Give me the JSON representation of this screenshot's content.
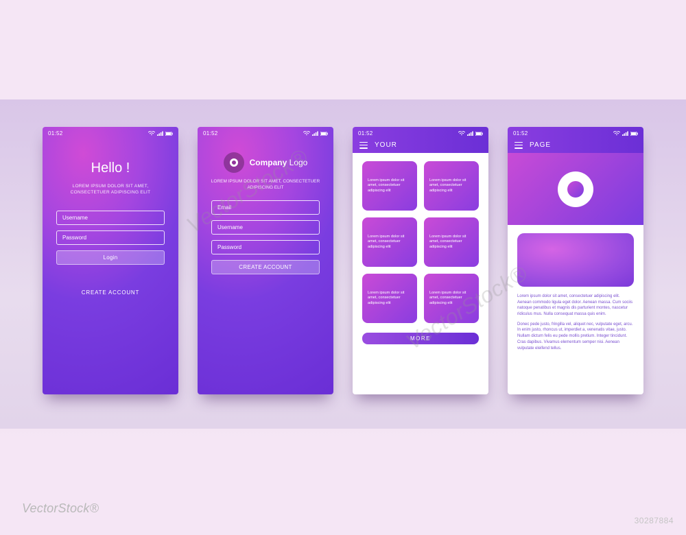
{
  "status": {
    "time": "01:52"
  },
  "screen1": {
    "title": "Hello !",
    "subtitle": "LOREM IPSUM DOLOR SIT AMET, CONSECTETUER ADIPISCING ELIT",
    "username_ph": "Username",
    "password_ph": "Password",
    "login_label": "Login",
    "create_link": "CREATE ACCOUNT"
  },
  "screen2": {
    "company_bold": "Company",
    "company_rest": " Logo",
    "subtitle": "LOREM IPSUM DOLOR SIT AMET, CONSECTETUER ADIPISCING ELIT",
    "email_ph": "Email",
    "username_ph": "Username",
    "password_ph": "Password",
    "create_label": "CREATE ACCOUNT"
  },
  "screen3": {
    "header": "YOUR",
    "card_text": "Lorem ipsum dolor sit amet, consectetuer adipiscing elit",
    "more_label": "MORE"
  },
  "screen4": {
    "header": "PAGE",
    "para1": "Lorem ipsum dolor sit amet, consectetuer adipiscing elit. Aenean commodo ligula eget dolor. Aenean massa. Cum sociis natoque penatibus et magnis dis parturient montes, nascetur ridiculus mus. Nulla consequat massa quis enim.",
    "para2": "Donec pede justo, fringilla vel, aliquet nec, vulputate eget, arcu. In enim justo, rhoncus ut, imperdiet a, venenatis vitae, justo. Nullam dictum felis eu pede mollis pretium. Integer tincidunt. Cras dapibus. Vivamus elementum semper nisi. Aenean vulputate eleifend tellus."
  },
  "watermarks": {
    "brand": "VectorStock®",
    "diag": "VectorStock®",
    "id": "30287884"
  }
}
